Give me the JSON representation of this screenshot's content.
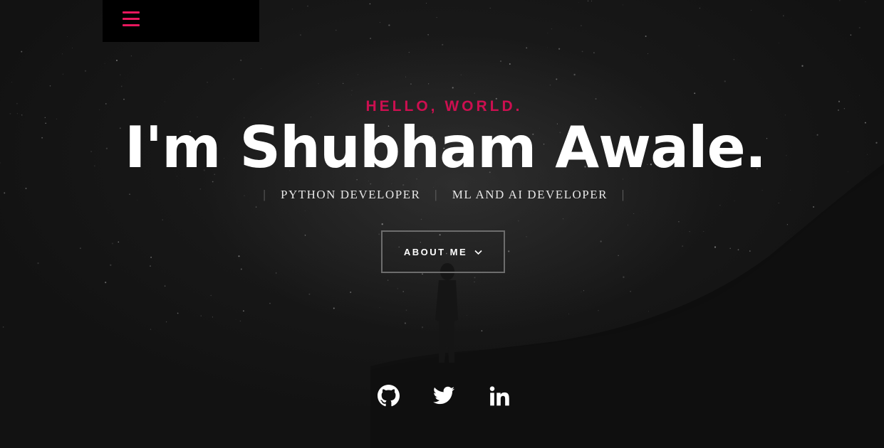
{
  "header": {
    "menu_icon": "hamburger-menu-icon",
    "accent_color": "#e8175d"
  },
  "intro": {
    "greeting": "HELLO, WORLD.",
    "name": "I'm Shubham Awale.",
    "roles": [
      "PYTHON DEVELOPER",
      "ML AND AI DEVELOPER"
    ],
    "separator": "|"
  },
  "about_button": {
    "label": "ABOUT ME",
    "icon": "chevron-down-icon"
  },
  "social": [
    {
      "name": "GitHub",
      "icon": "github-icon"
    },
    {
      "name": "Twitter",
      "icon": "twitter-icon"
    },
    {
      "name": "LinkedIn",
      "icon": "linkedin-icon"
    }
  ],
  "colors": {
    "background": "#121212",
    "accent": "#cc0f50",
    "text": "#ffffff"
  }
}
